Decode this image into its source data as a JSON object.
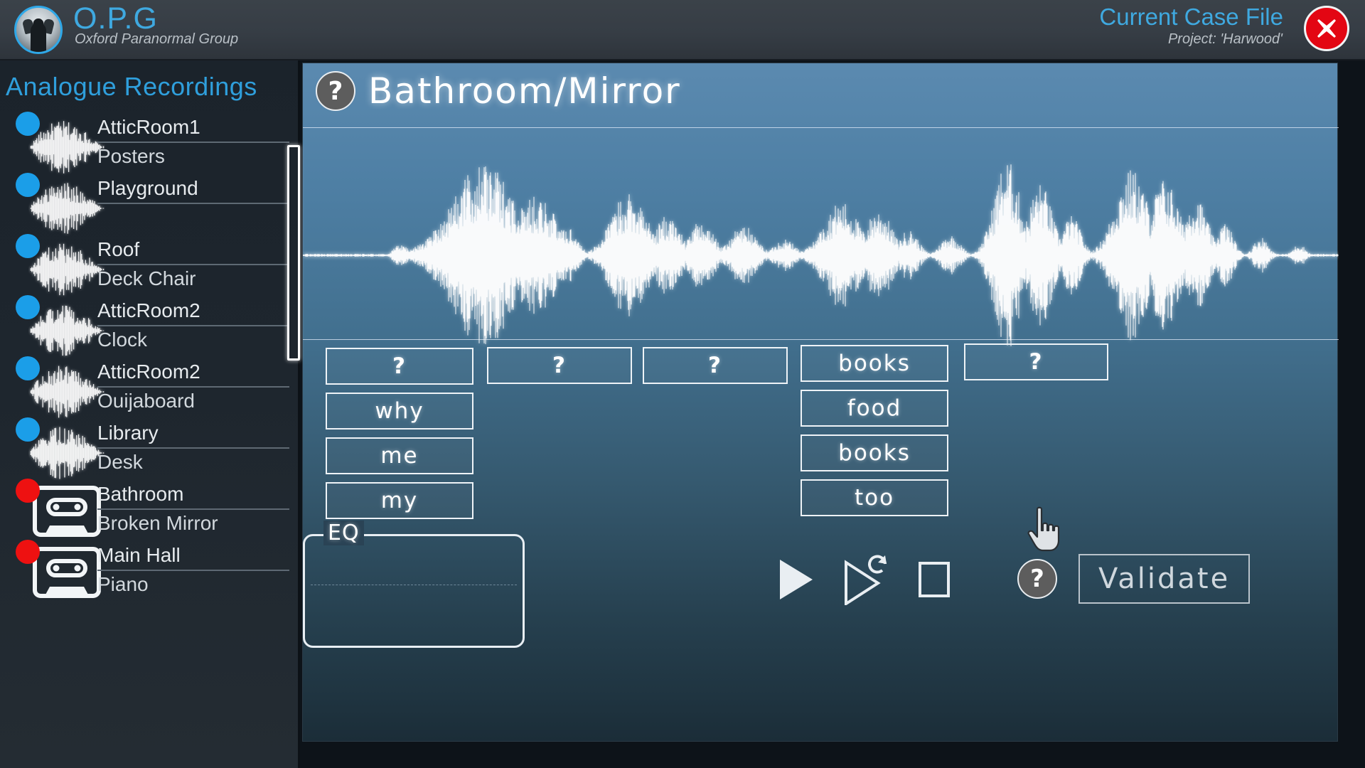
{
  "header": {
    "logo_icon": "ghost-hands-logo-icon",
    "brand_title": "O.P.G",
    "brand_subtitle": "Oxford Paranormal Group",
    "case_title": "Current Case File",
    "case_subtitle": "Project: 'Harwood'",
    "close_icon": "close-x-icon",
    "accent_color": "#3fa9e0",
    "close_color": "#e30613"
  },
  "sidebar": {
    "heading": "Analogue Recordings",
    "items": [
      {
        "status": "blue",
        "icon": "waveform-icon",
        "title": "AtticRoom1",
        "subtitle": "Posters"
      },
      {
        "status": "blue",
        "icon": "waveform-icon",
        "title": "Playground",
        "subtitle": ""
      },
      {
        "status": "blue",
        "icon": "waveform-icon",
        "title": "Roof",
        "subtitle": "Deck Chair"
      },
      {
        "status": "blue",
        "icon": "waveform-icon",
        "title": "AtticRoom2",
        "subtitle": "Clock"
      },
      {
        "status": "blue",
        "icon": "waveform-icon",
        "title": "AtticRoom2",
        "subtitle": "Ouijaboard"
      },
      {
        "status": "blue",
        "icon": "waveform-icon",
        "title": "Library",
        "subtitle": "Desk"
      },
      {
        "status": "red",
        "icon": "cassette-icon",
        "title": "Bathroom",
        "subtitle": "Broken Mirror"
      },
      {
        "status": "red",
        "icon": "cassette-icon",
        "title": "Main Hall",
        "subtitle": "Piano"
      }
    ],
    "status_colors": {
      "blue": "#1b9ee8",
      "red": "#ee1111"
    }
  },
  "main": {
    "help_icon": "question-mark-icon",
    "title": "Bathroom/Mirror",
    "playhead_name": "playhead-handle",
    "word_rows": [
      {
        "row": 1,
        "buttons": [
          "?",
          "?",
          "?",
          "books",
          "?"
        ]
      },
      {
        "row": 2,
        "buttons": [
          "why",
          "",
          "",
          "food",
          ""
        ]
      },
      {
        "row": 3,
        "buttons": [
          "me",
          "",
          "",
          "books",
          ""
        ]
      },
      {
        "row": 4,
        "buttons": [
          "my",
          "",
          "",
          "too",
          ""
        ]
      }
    ],
    "col1": [
      "?",
      "why",
      "me",
      "my"
    ],
    "col2": [
      "?"
    ],
    "col3": [
      "?"
    ],
    "col4": [
      "books",
      "food",
      "books",
      "too"
    ],
    "col5": [
      "?"
    ],
    "eq": {
      "legend": "EQ"
    },
    "transport": {
      "play_icon": "play-icon",
      "loop_play_icon": "play-loop-icon",
      "stop_icon": "stop-icon"
    },
    "validate": {
      "help_icon": "question-mark-icon",
      "label": "Validate"
    },
    "cursor_icon": "hand-pointer-cursor"
  }
}
